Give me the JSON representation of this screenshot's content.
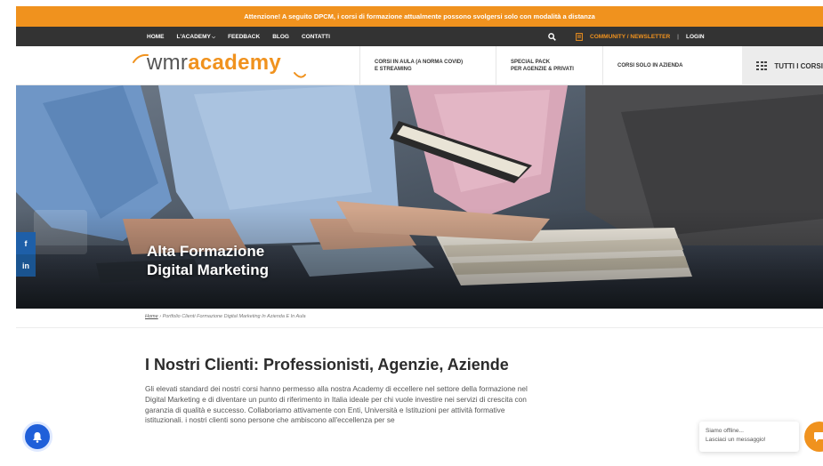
{
  "alert": {
    "text": "Attenzione! A seguito DPCM, i corsi di formazione attualmente possono svolgersi solo con modalità a distanza"
  },
  "topnav": {
    "links": [
      "HOME",
      "L'ACADEMY",
      "FEEDBACK",
      "BLOG",
      "CONTATTI"
    ],
    "community": "COMMUNITY / NEWSLETTER",
    "separator": "|",
    "login": "LOGIN"
  },
  "logo": {
    "prefix": "wmr",
    "brand": "academy"
  },
  "mainnav": {
    "item1": [
      "CORSI IN AULA (A NORMA COVID)",
      "E STREAMING"
    ],
    "item2": [
      "SPECIAL PACK",
      "PER AGENZIE & PRIVATI"
    ],
    "item3": "CORSI SOLO IN AZIENDA",
    "all_courses": "TUTTI I CORSI"
  },
  "hero": {
    "title_line1": "Alta Formazione",
    "title_line2": "Digital Marketing"
  },
  "social": {
    "facebook": "f",
    "linkedin": "in"
  },
  "breadcrumb": {
    "home": "Home",
    "separator": " › ",
    "current": "Portfolio Clienti Formazione Digital Marketing In Azienda E In Aula"
  },
  "content": {
    "heading": "I Nostri Clienti: Professionisti, Agenzie, Aziende",
    "paragraph": "Gli elevati standard dei nostri corsi hanno permesso alla nostra Academy di eccellere nel settore della formazione nel Digital Marketing e di diventare un punto di riferimento in Italia ideale per chi vuole investire nei servizi di crescita con garanzia di qualità e successo. Collaboriamo attivamente con Enti, Università e Istituzioni per attività formative istituzionali. i nostri clienti sono persone che ambiscono all'eccellenza per se"
  },
  "chat": {
    "status": "Siamo offline...",
    "prompt": "Lasciaci un messaggio!"
  },
  "colors": {
    "accent": "#f0921e",
    "dark_nav": "#333333",
    "social_blue": "#1e5fa8",
    "bell_blue": "#1f5fd9"
  }
}
